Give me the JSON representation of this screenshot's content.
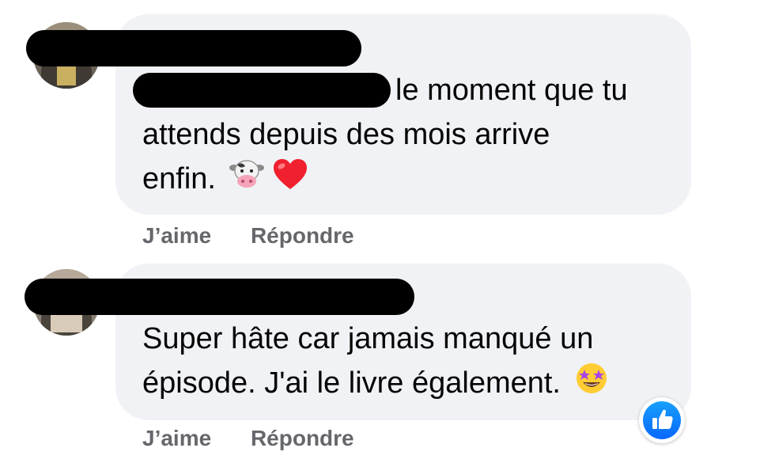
{
  "comments": [
    {
      "lines": [
        "le moment que tu",
        "attends depuis des mois arrive",
        "enfin."
      ],
      "emojis": [
        "cow-face-icon",
        "red-heart-icon"
      ],
      "actions": {
        "like": "J’aime",
        "reply": "Répondre"
      }
    },
    {
      "lines": [
        "Super hâte car jamais manqué un",
        "épisode. J'ai le livre également."
      ],
      "emojis": [
        "star-struck-icon"
      ],
      "actions": {
        "like": "J’aime",
        "reply": "Répondre"
      },
      "reaction": "like-reaction-icon"
    }
  ],
  "colors": {
    "bubble": "#f0f2f5",
    "text": "#050505",
    "action_text": "#65676b",
    "like_blue": "#0866ff",
    "redaction": "#000000"
  }
}
